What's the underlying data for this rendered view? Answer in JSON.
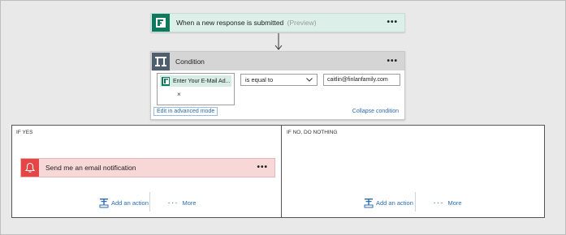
{
  "trigger": {
    "title": "When a new response is submitted",
    "preview": "(Preview)",
    "menu": "•••",
    "icon": "forms-icon"
  },
  "condition": {
    "title": "Condition",
    "menu": "•••",
    "token_label": "Enter Your E-Mail Ad...",
    "token_remove": "×",
    "operator": "is equal to",
    "value": "caitlin@finlanfamily.com",
    "advanced_link": "Edit in advanced mode",
    "collapse_link": "Collapse condition"
  },
  "branches": {
    "yes": {
      "label": "IF YES",
      "action_title": "Send me an email notification",
      "action_menu": "•••",
      "add_action": "Add an action",
      "more": "More"
    },
    "no": {
      "label": "IF NO, DO NOTHING",
      "add_action": "Add an action",
      "more": "More"
    }
  },
  "colors": {
    "forms_green": "#0d7a5e",
    "condition_gray": "#4f5f6f",
    "notification_red": "#e64545",
    "link_blue": "#2b6cb0"
  }
}
